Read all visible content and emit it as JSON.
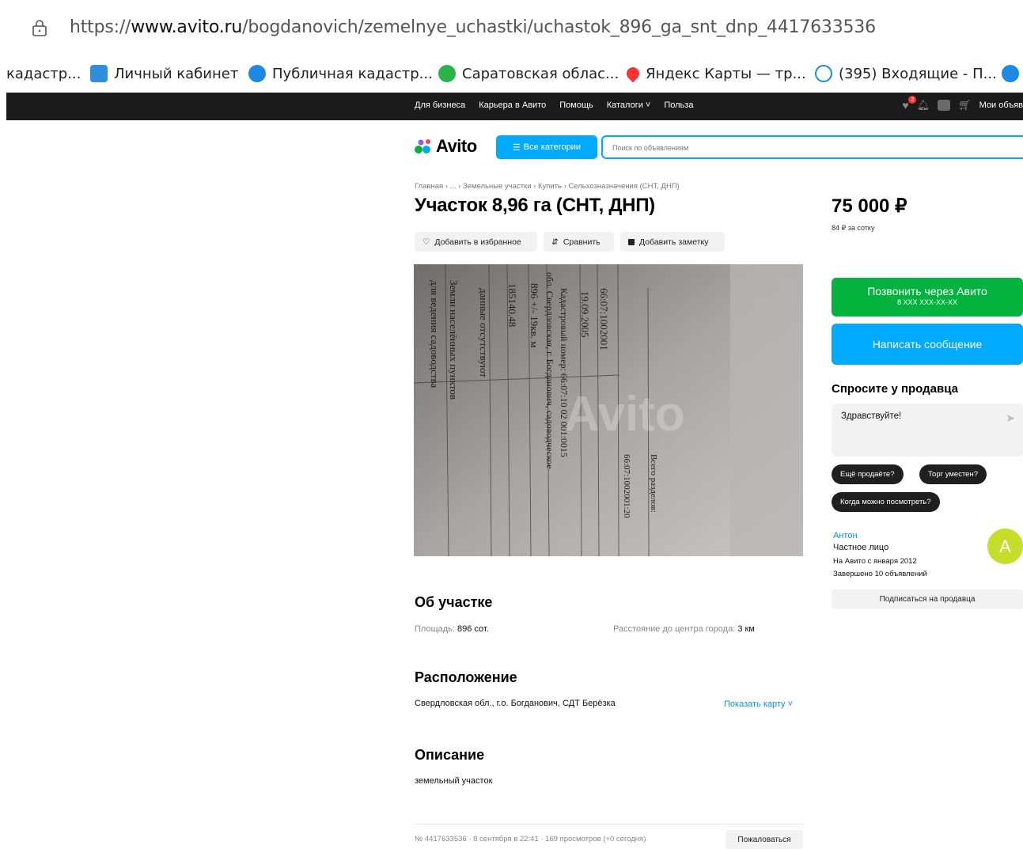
{
  "browser": {
    "url_prefix": "https://",
    "url_domain": "www.avito.ru",
    "url_path": "/bogdanovich/zemelnye_uchastki/uchastok_896_ga_snt_dnp_4417633536",
    "bookmarks": [
      {
        "label": "кадастр...",
        "icon": "none"
      },
      {
        "label": "Личный кабинет",
        "icon": "rosreestr-icon"
      },
      {
        "label": "Публичная кадастр...",
        "icon": "home-map-icon"
      },
      {
        "label": "Саратовская облас...",
        "icon": "check-circle-icon"
      },
      {
        "label": "Яндекс Карты — тр...",
        "icon": "map-pin-icon"
      },
      {
        "label": "(395) Входящие - П...",
        "icon": "mail-icon"
      }
    ]
  },
  "topnav": {
    "links": [
      "Для бизнеса",
      "Карьера в Авито",
      "Помощь",
      "Каталоги",
      "Польза"
    ],
    "my_ads": "Мои объяв",
    "favorites_badge": "2"
  },
  "header": {
    "logo": "Avito",
    "categories_button": "Все категории",
    "search_placeholder": "Поиск по объявлениям"
  },
  "listing": {
    "breadcrumb": "Главная › ... › Земельные участки › Купить › Сельхозназначения (СНТ, ДНП)",
    "title": "Участок 8,96 га (СНТ, ДНП)",
    "actions": {
      "favorite": "Добавить в избранное",
      "compare": "Сравнить",
      "note": "Добавить заметку"
    },
    "photo_lines": [
      "для ведения садоводства",
      "Земли населённых пунктов",
      "данные отсутствуют",
      "185140.48",
      "896 +/- 19кв. м",
      "обл. Свердловская, г. Богданович, садоводческое",
      "Кадастровый номер: 66:07:10 02 001:0015",
      "19.09.2005",
      "66:07:1002001"
    ],
    "photo_text_right": [
      "66:07:1002001:20",
      "Всего разделов:"
    ],
    "photo_watermark": "Avito",
    "about_heading": "Об участке",
    "area_label": "Площадь:",
    "area_value": "896 сот.",
    "distance_label": "Расстояние до центра города:",
    "distance_value": "3 км",
    "location_heading": "Расположение",
    "address": "Свердловская обл., г.о. Богданович, СДТ Берёзка",
    "show_map": "Показать карту ˅",
    "description_heading": "Описание",
    "description": "земельный участок",
    "footer": "№ 4417633536 · 8 сентября в 22:41 · 169 просмотров (+0 сегодня)",
    "report": "Пожаловаться"
  },
  "sidebar": {
    "price": "75 000 ₽",
    "price_per_unit": "84 ₽ за сотку",
    "call_button": "Позвонить через Авито",
    "call_phone": "8 XXX XXX-XX-XX",
    "message_button": "Написать сообщение",
    "ask_heading": "Спросите у продавца",
    "ask_message": "Здравствуйте!",
    "quick_replies": [
      "Ещё продаёте?",
      "Торг уместен?",
      "Когда можно посмотреть?"
    ],
    "seller": {
      "name": "Антон",
      "type": "Частное лицо",
      "since": "На Авито с января 2012",
      "completed": "Завершено 10 объявлений",
      "avatar_letter": "A"
    },
    "subscribe": "Подписаться на продавца"
  },
  "colors": {
    "accent_blue": "#00aaff",
    "call_green": "#04b33d",
    "avatar": "#c6dd2a",
    "topnav_bg": "#1b1b1b"
  }
}
